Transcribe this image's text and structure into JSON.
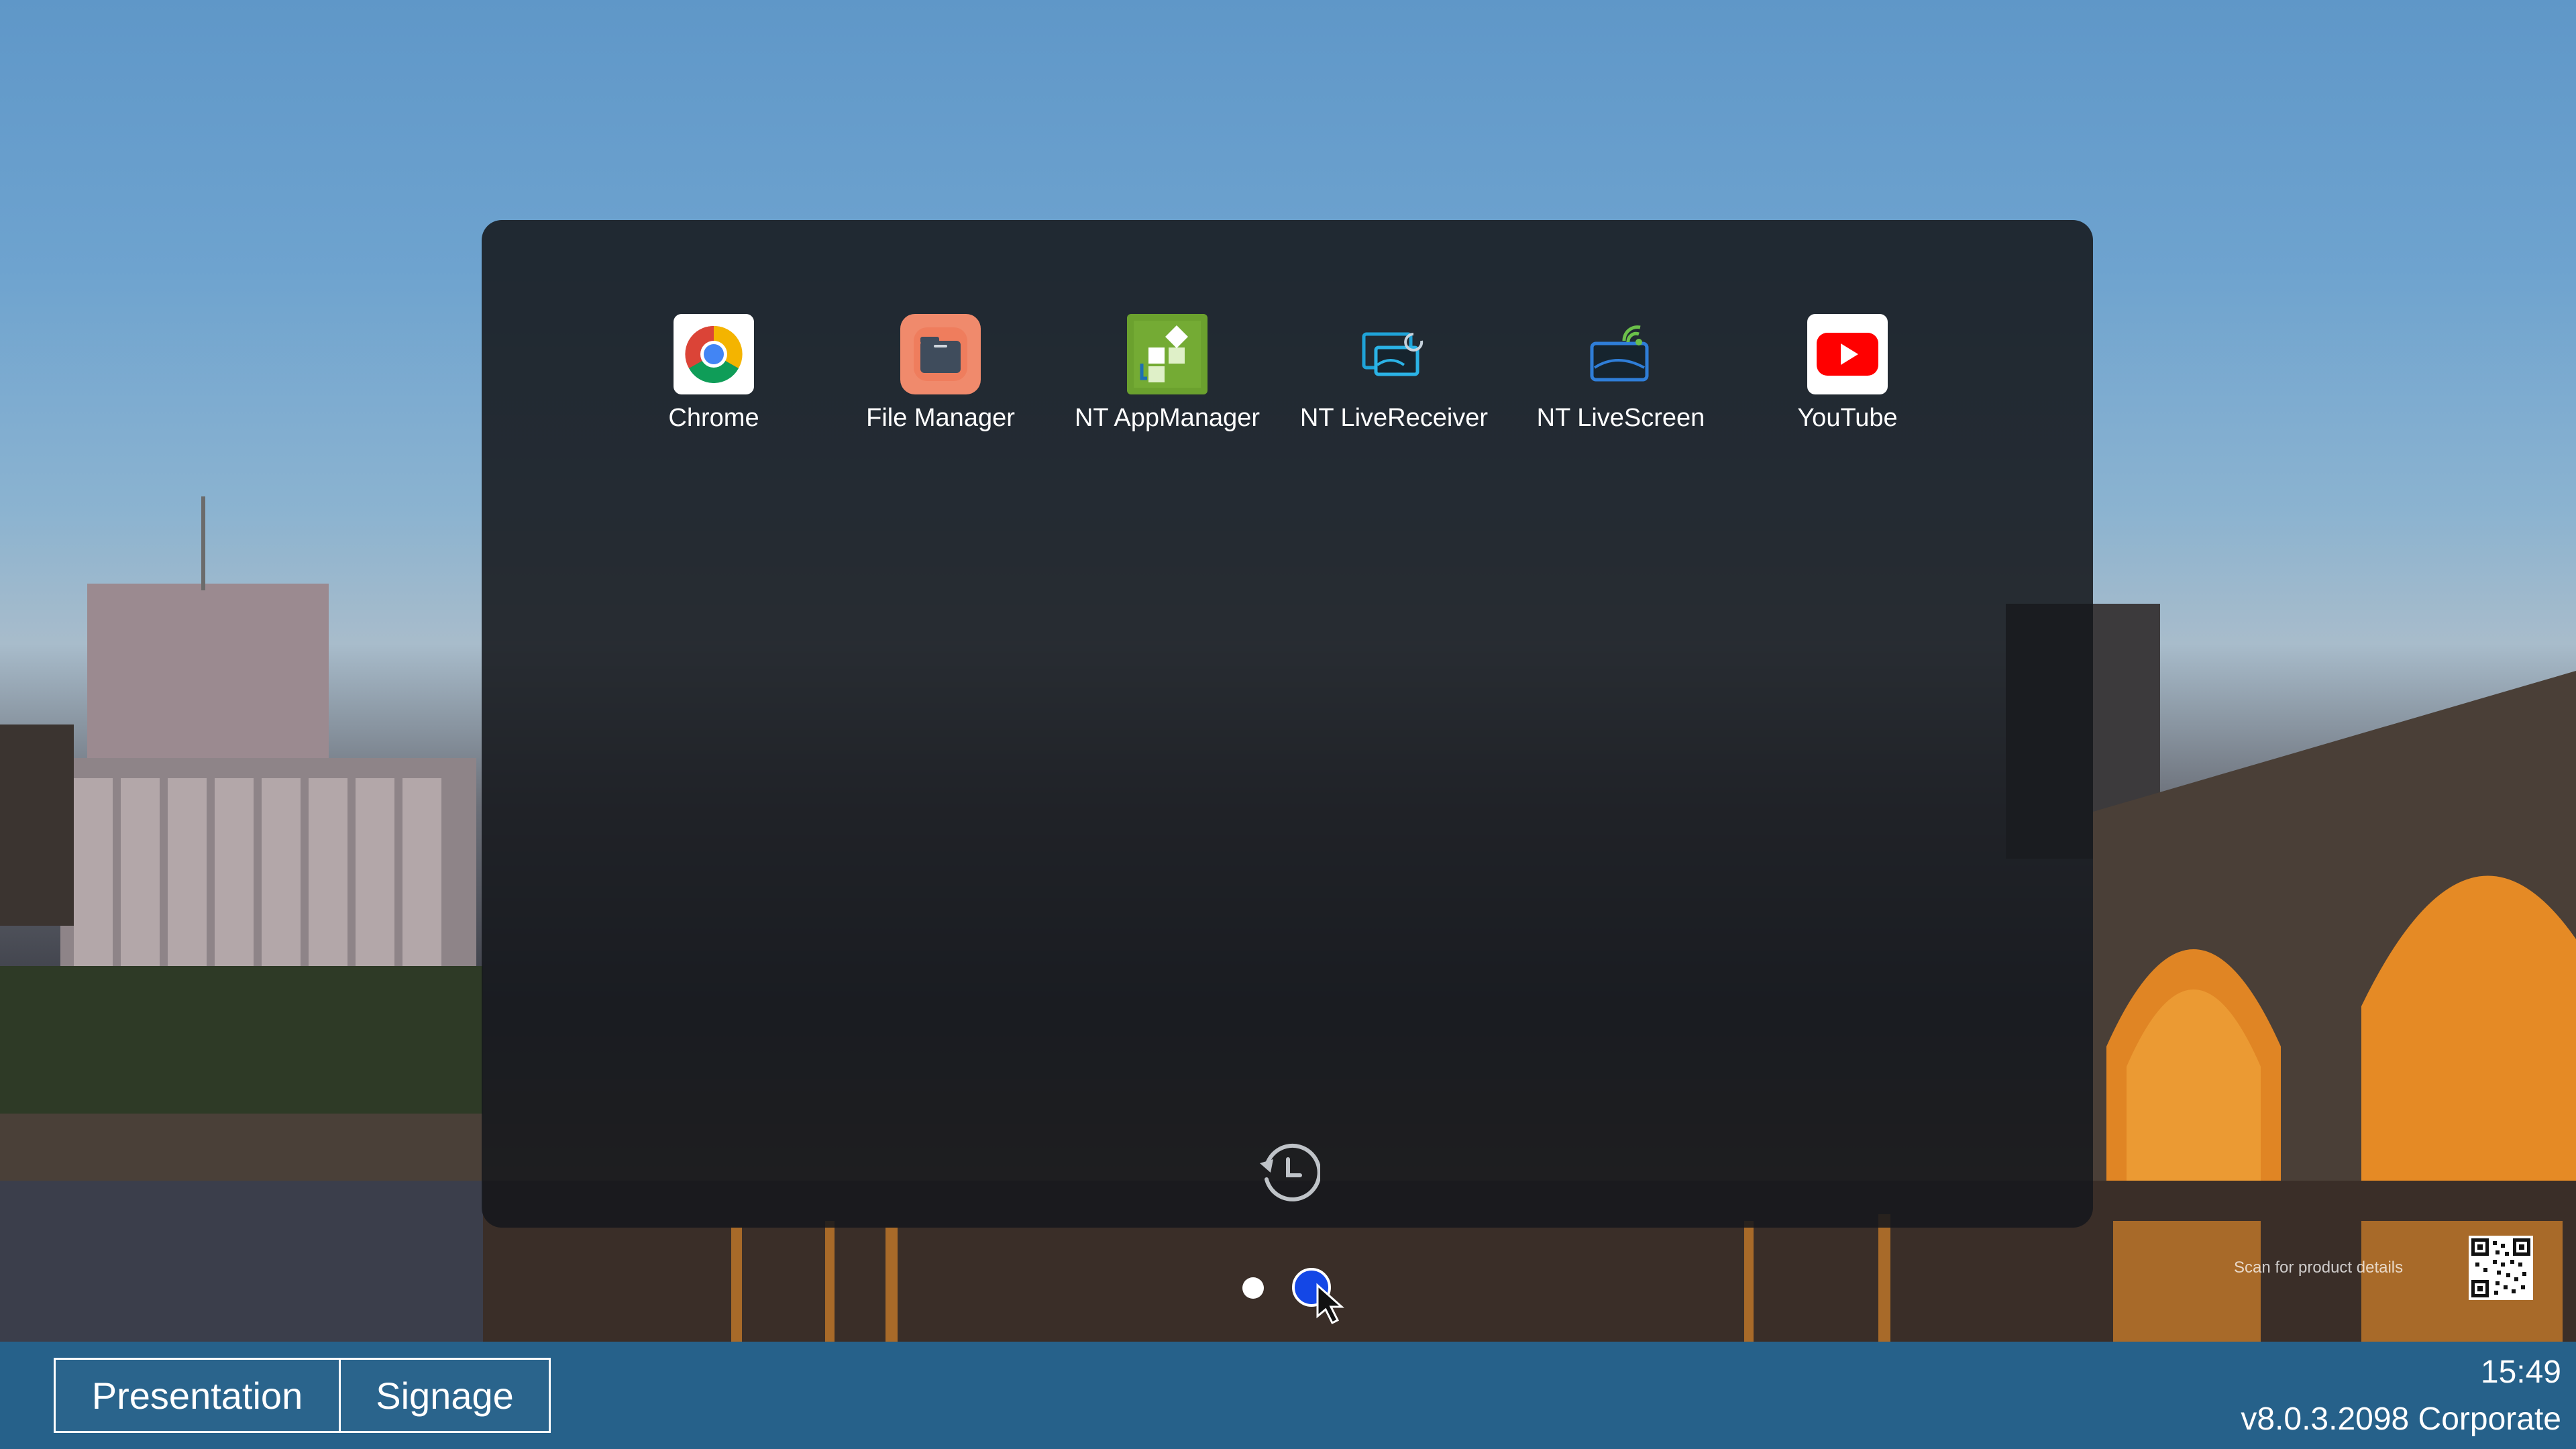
{
  "launcher": {
    "apps": [
      {
        "label": "Chrome",
        "icon": "chrome-icon"
      },
      {
        "label": "File Manager",
        "icon": "folder-icon"
      },
      {
        "label": "NT AppManager",
        "icon": "appmanager-icon"
      },
      {
        "label": "NT LiveReceiver",
        "icon": "livereceiver-icon"
      },
      {
        "label": "NT LiveScreen",
        "icon": "livescreen-icon"
      },
      {
        "label": "YouTube",
        "icon": "youtube-icon"
      }
    ],
    "recents_icon": "history-icon",
    "pager": {
      "pages": 2,
      "current": 2
    },
    "accent_color": "#1447e6"
  },
  "qr": {
    "caption": "Scan for product details",
    "icon": "qr-code-icon"
  },
  "taskbar": {
    "presentation_label": "Presentation",
    "signage_label": "Signage",
    "time": "15:49",
    "version": "v8.0.3.2098 Corporate",
    "bar_color": "#145480"
  }
}
